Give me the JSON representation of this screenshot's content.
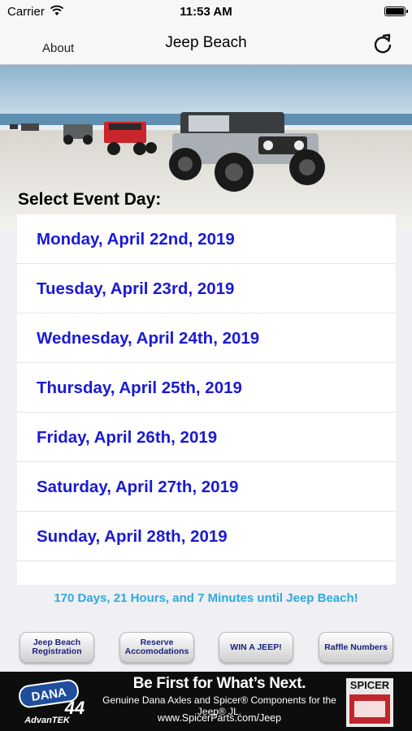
{
  "status_bar": {
    "carrier": "Carrier",
    "time": "11:53 AM"
  },
  "nav": {
    "about_label": "About",
    "title": "Jeep Beach"
  },
  "select_label": "Select Event Day:",
  "days": [
    "Monday, April 22nd, 2019",
    "Tuesday, April 23rd, 2019",
    "Wednesday, April 24th, 2019",
    "Thursday, April 25th, 2019",
    "Friday, April 26th, 2019",
    "Saturday, April 27th, 2019",
    "Sunday, April 28th, 2019"
  ],
  "countdown": "170 Days, 21 Hours, and 7 Minutes until Jeep Beach!",
  "buttons": {
    "registration": "Jeep Beach Registration",
    "accommodations": "Reserve Accomodations",
    "win": "WIN A JEEP!",
    "raffle": "Raffle Numbers"
  },
  "ad": {
    "dana_brand": "DANA",
    "dana_number": "44",
    "dana_sub": "AdvanTEK",
    "headline": "Be First for What’s Next.",
    "subline": "Genuine Dana Axles and Spicer® Components for the Jeep® JL.",
    "url": "www.SpicerParts.com/Jeep",
    "spicer_brand": "SPICER"
  },
  "colors": {
    "day_link": "#1a1ad4",
    "countdown": "#2eaadc",
    "button_text": "#1a237e"
  }
}
